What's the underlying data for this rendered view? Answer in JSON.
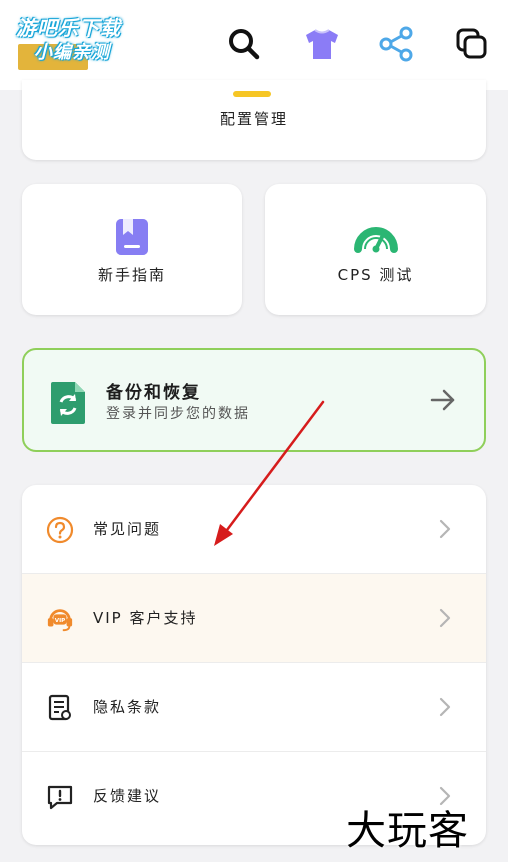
{
  "watermark_logo": {
    "line1": "游吧乐下载",
    "line2": "小编亲测"
  },
  "topbar": {
    "icons": [
      "search-icon",
      "tshirt-icon",
      "share-icon",
      "copy-icon"
    ],
    "colors": {
      "tshirt": "#8b7cf6",
      "share": "#4ea8e8",
      "indicator": "#f6c625"
    }
  },
  "config": {
    "label": "配置管理"
  },
  "cards": {
    "guide": {
      "label": "新手指南",
      "icon": "bookmark-icon",
      "color": "#7c72f2"
    },
    "cps": {
      "label": "CPS 测试",
      "icon": "gauge-icon",
      "color": "#2bb673"
    }
  },
  "backup": {
    "title": "备份和恢复",
    "subtitle": "登录并同步您的数据",
    "icon": "file-sync-icon",
    "color": "#2e9d6e",
    "border_color": "#8fcf5a"
  },
  "list": [
    {
      "label": "常见问题",
      "icon": "question-icon"
    },
    {
      "label": "VIP 客户支持",
      "icon": "headset-icon"
    },
    {
      "label": "隐私条款",
      "icon": "document-icon"
    },
    {
      "label": "反馈建议",
      "icon": "feedback-icon"
    }
  ],
  "watermark_brand": "大玩客"
}
